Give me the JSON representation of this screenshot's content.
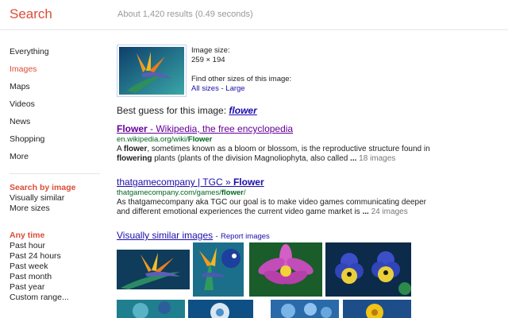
{
  "header": {
    "brand": "Search",
    "stats": "About 1,420 results (0.49 seconds)"
  },
  "sidebar": {
    "nav": [
      "Everything",
      "Images",
      "Maps",
      "Videos",
      "News",
      "Shopping",
      "More"
    ],
    "active_index": 1,
    "search_by_image": {
      "title": "Search by image",
      "links": [
        "Visually similar",
        "More sizes"
      ]
    },
    "any_time": {
      "title": "Any time",
      "links": [
        "Past hour",
        "Past 24 hours",
        "Past week",
        "Past month",
        "Past year",
        "Custom range..."
      ]
    }
  },
  "image_info": {
    "size_label": "Image size:",
    "size_value": "259 × 194",
    "other_sizes_label": "Find other sizes of this image:",
    "all_sizes": "All sizes",
    "separator": "-",
    "large": "Large"
  },
  "best_guess": {
    "label": "Best guess for this image:",
    "term": "flower"
  },
  "results": [
    {
      "title_bold": "Flower",
      "title_rest": " - Wikipedia, the free encyclopedia",
      "url_plain": "en.wikipedia.org/wiki/",
      "url_bold": "Flower",
      "snippet_1a": "A ",
      "snippet_1b": "flower",
      "snippet_1c": ", sometimes known as a bloom or blossom, is the reproductive structure found in",
      "snippet_2a": "flowering",
      "snippet_2b": " plants (plants of the division Magnoliophyta, also called ",
      "ellipsis": "...",
      "more": "18 images"
    },
    {
      "title_rest": "thatgamecompany | TGC » ",
      "title_bold": "Flower",
      "url_plain": "thatgamecompany.com/games/",
      "url_bold": "flower",
      "url_tail": "/",
      "snippet_1": "As thatgamecompany aka TGC our goal is to make video games communicating deeper",
      "snippet_2": "and different emotional experiences the current video game market is ",
      "ellipsis": "...",
      "more": "24 images"
    }
  ],
  "similar": {
    "title": "Visually similar images",
    "separator": "-",
    "report": "Report images"
  },
  "colors": {
    "brand": "#dd4b39",
    "link": "#1a0dab",
    "visited": "#609",
    "url": "#006621"
  }
}
